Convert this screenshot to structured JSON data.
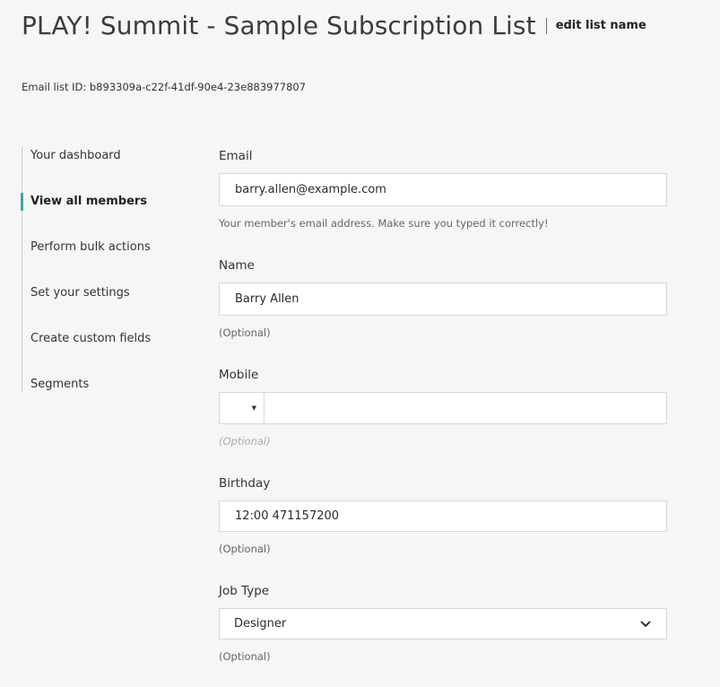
{
  "header": {
    "title": "PLAY! Summit - Sample Subscription List",
    "edit_link": "edit list name"
  },
  "list_id": "Email list ID: b893309a-c22f-41df-90e4-23e883977807",
  "sidebar": {
    "items": [
      {
        "label": "Your dashboard",
        "active": false
      },
      {
        "label": "View all members",
        "active": true
      },
      {
        "label": "Perform bulk actions",
        "active": false
      },
      {
        "label": "Set your settings",
        "active": false
      },
      {
        "label": "Create custom fields",
        "active": false
      },
      {
        "label": "Segments",
        "active": false
      }
    ]
  },
  "form": {
    "email": {
      "label": "Email",
      "value": "barry.allen@example.com",
      "help": "Your member's email address. Make sure you typed it correctly!"
    },
    "name": {
      "label": "Name",
      "value": "Barry Allen",
      "help": "(Optional)"
    },
    "mobile": {
      "label": "Mobile",
      "country_code": "",
      "value": "",
      "help": "(Optional)"
    },
    "birthday": {
      "label": "Birthday",
      "value": "12:00 471157200",
      "help": "(Optional)"
    },
    "job_type": {
      "label": "Job Type",
      "selected": "Designer",
      "help": "(Optional)"
    }
  },
  "colors": {
    "background": "#f6f6f6",
    "accent": "#3aa5ae",
    "border": "#d6d6d6"
  },
  "icons": {
    "mobile_country_dropdown": "caret-down-icon",
    "job_type_dropdown": "chevron-down-icon"
  }
}
